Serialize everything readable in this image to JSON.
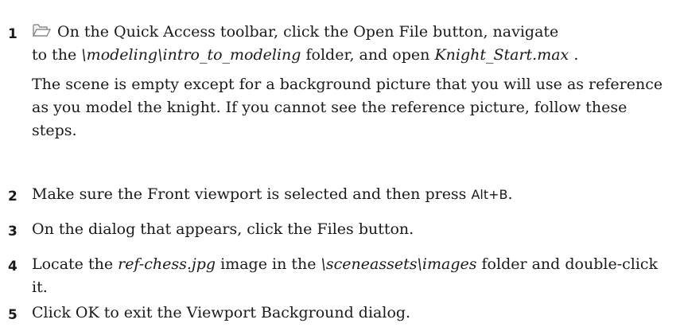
{
  "steps": [
    {
      "number": "1",
      "icon": "open-folder-icon",
      "line1": "On the Quick Access toolbar, click the Open File button, navigate",
      "line2_pre": "to the ",
      "line2_path": "\\modeling\\intro_to_modeling",
      "line2_mid": " folder, and open ",
      "line2_file": "Knight_Start.max",
      "line2_post": " .",
      "note": "The scene is empty except for a background picture that you will use as reference as you model the knight. If you cannot see the reference picture, follow these steps."
    },
    {
      "number": "2",
      "text_pre": "Make sure the Front viewport is selected and then press ",
      "key": "Alt+B",
      "text_post": "."
    },
    {
      "number": "3",
      "text": "On the dialog that appears, click the Files button."
    },
    {
      "number": "4",
      "text_pre": "Locate the ",
      "file": "ref-chess.jpg",
      "text_mid": " image in the ",
      "folder": "\\sceneassets\\images",
      "text_post": " folder and double-click it."
    },
    {
      "number": "5",
      "text": "Click OK to exit the Viewport Background dialog."
    }
  ]
}
